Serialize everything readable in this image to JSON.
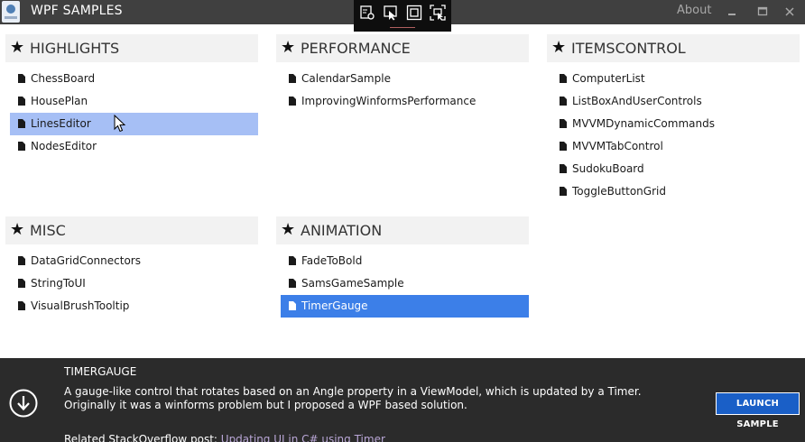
{
  "window": {
    "title": "WPF SAMPLES",
    "about_label": "About",
    "icons": {
      "app": "app-logo-icon",
      "minimize": "minimize-icon",
      "maximize": "maximize-icon",
      "close": "close-icon"
    }
  },
  "debug_toolbar": {
    "icons": [
      "live-visual-tree-icon",
      "select-element-icon",
      "display-layout-adorners-icon",
      "track-focus-icon"
    ]
  },
  "groups": [
    {
      "title": "HIGHLIGHTS",
      "items": [
        {
          "label": "ChessBoard",
          "state": "normal"
        },
        {
          "label": "HousePlan",
          "state": "normal"
        },
        {
          "label": "LinesEditor",
          "state": "hover"
        },
        {
          "label": "NodesEditor",
          "state": "normal"
        }
      ]
    },
    {
      "title": "PERFORMANCE",
      "items": [
        {
          "label": "CalendarSample",
          "state": "normal"
        },
        {
          "label": "ImprovingWinformsPerformance",
          "state": "normal"
        }
      ]
    },
    {
      "title": "ITEMSCONTROL",
      "items": [
        {
          "label": "ComputerList",
          "state": "normal"
        },
        {
          "label": "ListBoxAndUserControls",
          "state": "normal"
        },
        {
          "label": "MVVMDynamicCommands",
          "state": "normal"
        },
        {
          "label": "MVVMTabControl",
          "state": "normal"
        },
        {
          "label": "SudokuBoard",
          "state": "normal"
        },
        {
          "label": "ToggleButtonGrid",
          "state": "normal"
        }
      ]
    },
    {
      "title": "MISC",
      "items": [
        {
          "label": "DataGridConnectors",
          "state": "normal"
        },
        {
          "label": "StringToUI",
          "state": "normal"
        },
        {
          "label": "VisualBrushTooltip",
          "state": "normal"
        }
      ]
    },
    {
      "title": "ANIMATION",
      "items": [
        {
          "label": "FadeToBold",
          "state": "normal"
        },
        {
          "label": "SamsGameSample",
          "state": "normal"
        },
        {
          "label": "TimerGauge",
          "state": "selected"
        }
      ]
    }
  ],
  "details": {
    "title": "TIMERGAUGE",
    "description_line1": "A gauge-like control that rotates based on an Angle property in a ViewModel, which is updated by a Timer.",
    "description_line2": "Originally it was a winforms problem but I proposed a WPF based solution.",
    "related_prefix": "Related StackOverflow post: ",
    "related_link": "Updating UI in C# using Timer",
    "launch_label": "LAUNCH SAMPLE",
    "icon": "arrow-down-circle-icon"
  },
  "colors": {
    "titlebar": "#404040",
    "hover_row": "#a6bff5",
    "selected_row": "#3c7fe8",
    "details_panel": "#2b2b2b",
    "launch_button": "#1a5fc7",
    "link": "#b9a6d6"
  }
}
